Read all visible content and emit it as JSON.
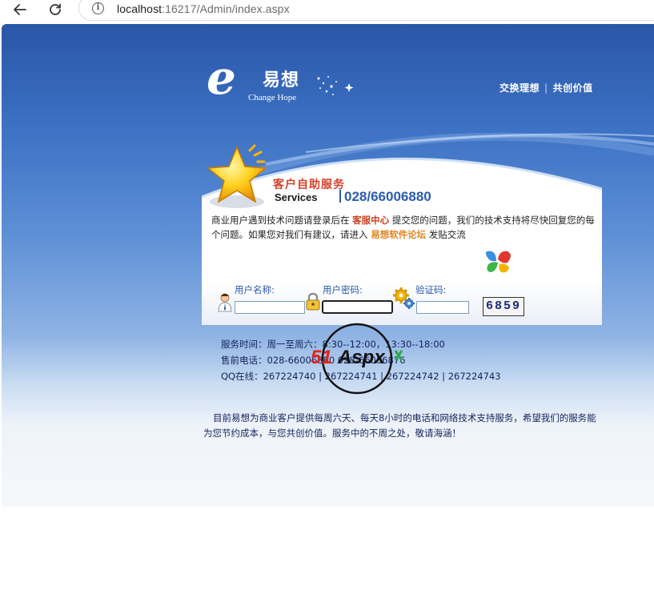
{
  "browser": {
    "back_icon": "arrow-left-icon",
    "reload_icon": "reload-icon",
    "url_host": "localhost",
    "url_rest": ":16217/Admin/index.aspx"
  },
  "header": {
    "logo_cn": "易想",
    "logo_en": "Change Hope",
    "slogan_left": "交换理想",
    "slogan_sep": "|",
    "slogan_right": "共创价值"
  },
  "service": {
    "title_cn": "客户自助服务",
    "title_en": "Services",
    "phone": "028/66006880"
  },
  "intro": {
    "part1": "商业用户遇到技术问题请登录后在 ",
    "link_center": "客服中心",
    "part2": " 提交您的问题，我们的技术支持将尽快回复您的每个问题。如果您对我们有建议，请进入 ",
    "link_forum": "易想软件论坛",
    "part3": " 发贴交流"
  },
  "login": {
    "username_label": "用户名称:",
    "username_value": "",
    "password_label": "用户密码:",
    "password_value": "",
    "captcha_label": "验证码:",
    "captcha_value": "",
    "captcha_image_text": "6859"
  },
  "contact": {
    "hours": "服务时间：周一至周六：8:30--12:00，13:30--18:00",
    "phone": "售前电话：028-66006880  028-66006876",
    "qq": "QQ在线：267224740 | 267224741 | 267224742 | 267224743"
  },
  "watermark": {
    "text_red": "51",
    "text_black": "Aspx"
  },
  "footer": {
    "text": "目前易想为商业客户提供每周六天、每天8小时的电话和网络技术支持服务，希望我们的服务能为您节约成本，与您共创价值。服务中的不周之处，敬请海涵！"
  },
  "colors": {
    "page_blue": "#2a56a6",
    "accent_red": "#d4412a",
    "accent_orange": "#e08420",
    "text_navy": "#13235a"
  }
}
